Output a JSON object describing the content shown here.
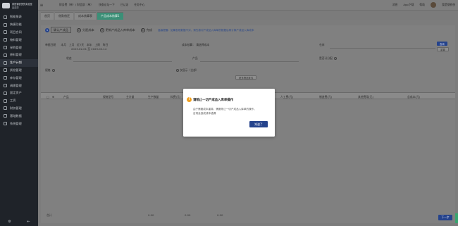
{
  "sidebar": {
    "brand_title": "我是钢铁侠的实验室",
    "brand_sub": "晶鼎配",
    "items": [
      {
        "label": "智能报表",
        "active": false
      },
      {
        "label": "快捷功能",
        "active": false
      },
      {
        "label": "项目合同",
        "active": false
      },
      {
        "label": "物料管理",
        "active": false
      },
      {
        "label": "采购管理",
        "active": false
      },
      {
        "label": "原料管理",
        "active": false
      },
      {
        "label": "生产计划",
        "active": true
      },
      {
        "label": "质检管理",
        "active": false
      },
      {
        "label": "库存管理",
        "active": false
      },
      {
        "label": "调拨管理",
        "active": false
      },
      {
        "label": "固定资产",
        "active": false
      },
      {
        "label": "工资",
        "active": false
      },
      {
        "label": "财务管理",
        "active": false
      },
      {
        "label": "基础数据",
        "active": false
      },
      {
        "label": "系统管理",
        "active": false
      }
    ],
    "bottom_left": "⚙",
    "bottom_right": "⇤"
  },
  "topbar": {
    "left_items": [
      "财务费（单）/ 财会部（单）",
      "快查论坛一下",
      "已认证",
      "任务中心"
    ],
    "right_items": [
      "消息",
      "App下载",
      "帮助"
    ],
    "user": "我是钢铁侠"
  },
  "tabs": [
    {
      "label": "首页",
      "active": false
    },
    {
      "label": "借款借还",
      "active": false
    },
    {
      "label": "成本核算表",
      "active": false
    },
    {
      "label": "产品成本核算1",
      "active": true
    }
  ],
  "steps": [
    {
      "num": "1",
      "label": "确认产成品",
      "current": true
    },
    {
      "num": "2",
      "label": "分配成本",
      "current": false
    },
    {
      "num": "3",
      "label": "更新产成品入库单成本",
      "current": false
    },
    {
      "num": "4",
      "label": "完成",
      "current": false
    }
  ],
  "hint_link": "温馨提醒：如果发现数据不对，请先核对产成品入库单的数据后再计算产成品入库成本",
  "filters": {
    "date_label": "单据日期",
    "date_options": "本月　上月　近7天　本年　上周　昨日",
    "date_range": "2023-02-01 至 2023-02-14",
    "doc_label": "成本核算：",
    "doc_value": "请选择成本",
    "warehouse_label": "仓库",
    "product_label": "产品",
    "status_label": "状态",
    "unit_label": "是否计分配",
    "spec_label": "规格",
    "check_label": "开单不需要分配",
    "check_label2": "仅显示（全部）",
    "query_btn": "查询",
    "reset_btn": "重置",
    "more_btn": "更多筛选条件"
  },
  "table": {
    "headers": [
      "产品",
      "规格型号",
      "主计量",
      "生产数量",
      "料费(元)",
      "人工费(元)",
      "制造费(元)",
      "其他费用(元)",
      "总成本(元)"
    ],
    "footer_label": "合计",
    "footer_values": [
      "0.00",
      "0.00",
      "0.00"
    ]
  },
  "next_btn": "下一步",
  "modal": {
    "icon": "!",
    "title": "请稍止一切产成品入库单操作",
    "body_line1": "由于需要成本重算，需要停止一切产成品入库单的操作，",
    "body_line2": "否则会造成成本错漏",
    "button": "知道了"
  }
}
